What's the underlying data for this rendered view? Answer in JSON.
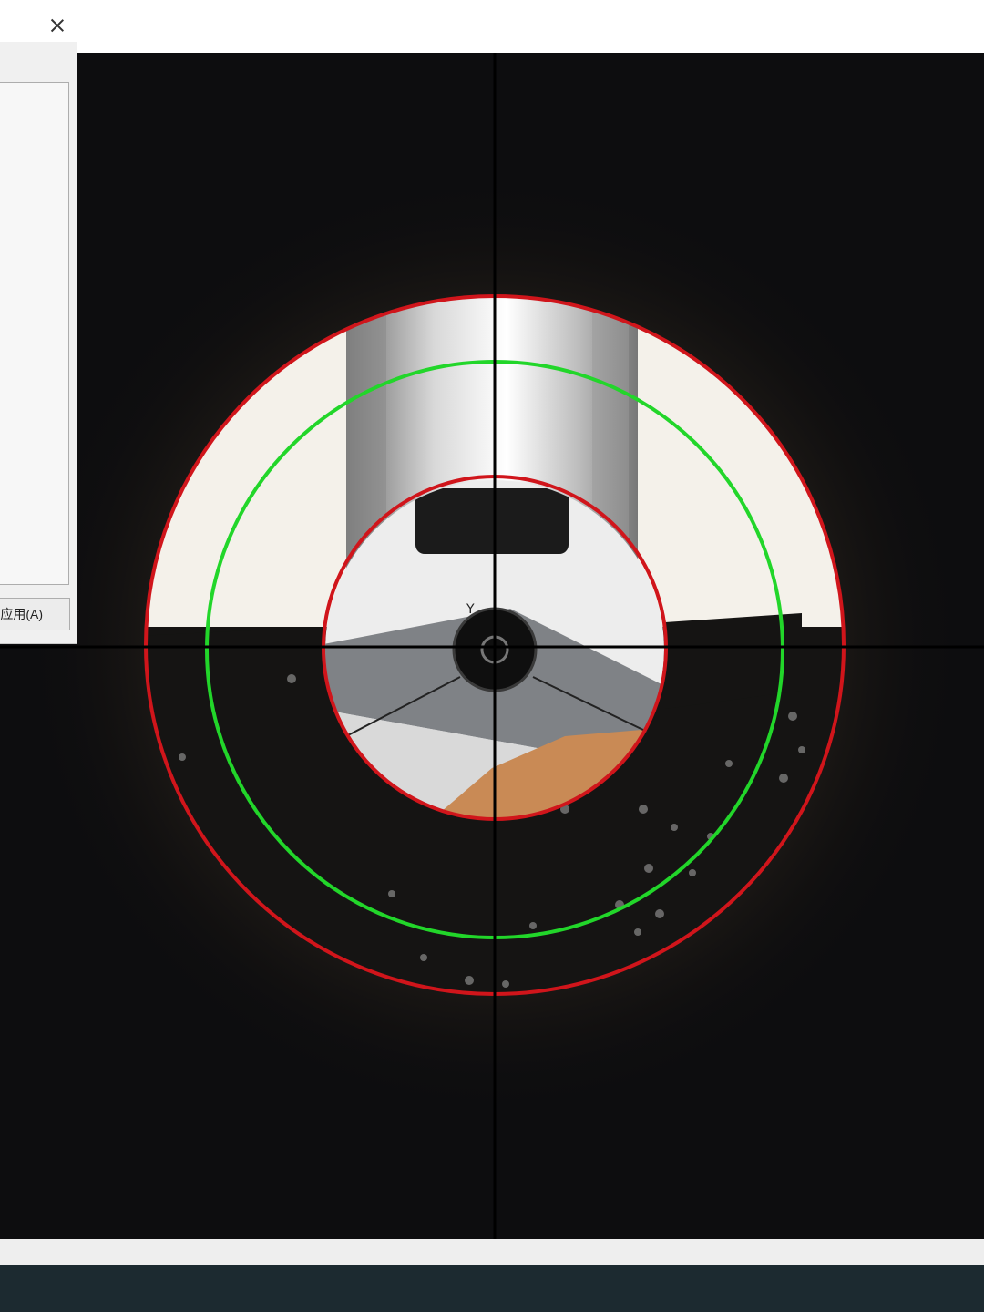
{
  "dialog": {
    "apply_button_label": "应用(A)",
    "close_icon": "close-icon"
  },
  "camera_overlay": {
    "crosshair_color": "#000000",
    "outer_circle_color": "#d0151b",
    "middle_circle_color": "#22d62a",
    "inner_circle_color": "#d0151b",
    "center_marker_label": "Y"
  },
  "colors": {
    "background": "#0d0d0f",
    "taskbar": "#1c2a30",
    "dialog": "#f0f0f0"
  }
}
